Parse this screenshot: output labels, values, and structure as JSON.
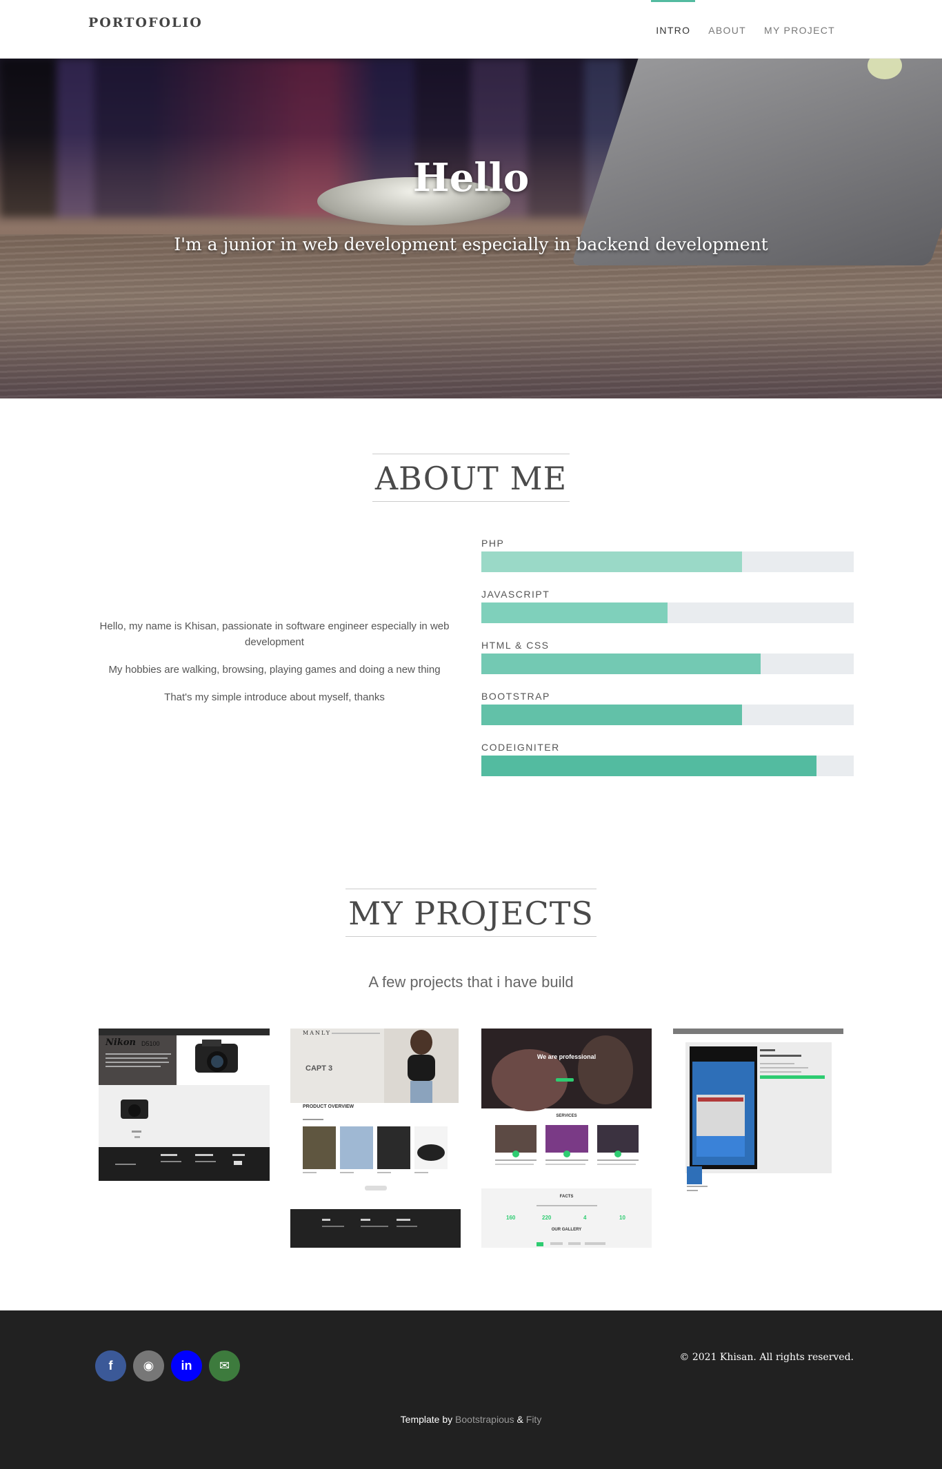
{
  "nav": {
    "brand": "PORTOFOLIO",
    "items": [
      {
        "label": "INTRO",
        "active": true
      },
      {
        "label": "ABOUT",
        "active": false
      },
      {
        "label": "MY PROJECT",
        "active": false
      }
    ]
  },
  "hero": {
    "title": "Hello",
    "subtitle": "I'm a junior in web development especially in backend development"
  },
  "about": {
    "title": "ABOUT ME",
    "paragraphs": [
      "Hello, my name is Khisan, passionate in software engineer especially in web development",
      "My hobbies are walking, browsing, playing games and doing a new thing",
      "That's my simple introduce about myself, thanks"
    ],
    "skills": [
      {
        "label": "PHP",
        "percent": 70,
        "color": "#9ad9c7"
      },
      {
        "label": "JAVASCRIPT",
        "percent": 50,
        "color": "#7fd0bb"
      },
      {
        "label": "HTML & CSS",
        "percent": 75,
        "color": "#73c9b3"
      },
      {
        "label": "BOOTSTRAP",
        "percent": 70,
        "color": "#62c1a8"
      },
      {
        "label": "CODEIGNITER",
        "percent": 90,
        "color": "#53bba0"
      }
    ]
  },
  "projects": {
    "title": "MY PROJECTS",
    "subtitle": "A few projects that i have build",
    "thumbs": [
      {
        "name": "nikon",
        "heading": "Nikon",
        "model": "D5100"
      },
      {
        "name": "manly",
        "brand": "MANLY",
        "headline": "CAPT 3",
        "section": "PRODUCT OVERVIEW"
      },
      {
        "name": "wedding",
        "headline": "We are professional",
        "services": "SERVICES",
        "facts": "FACTS",
        "gallery": "OUR GALLERY",
        "stats": [
          "160",
          "220",
          "4",
          "10"
        ]
      },
      {
        "name": "school"
      }
    ]
  },
  "footer": {
    "social": [
      {
        "icon": "facebook-icon",
        "glyph": "f",
        "color": "#3b5998"
      },
      {
        "icon": "github-icon",
        "glyph": "◉",
        "color": "#777777"
      },
      {
        "icon": "linkedin-icon",
        "glyph": "in",
        "color": "#0000ff"
      },
      {
        "icon": "mail-icon",
        "glyph": "✉",
        "color": "#3d7b3d"
      }
    ],
    "copyright": "© 2021 Khisan. All rights reserved.",
    "credit_prefix": "Template by",
    "credit_link1": "Bootstrapious",
    "credit_amp": "&",
    "credit_link2": "Fity"
  }
}
